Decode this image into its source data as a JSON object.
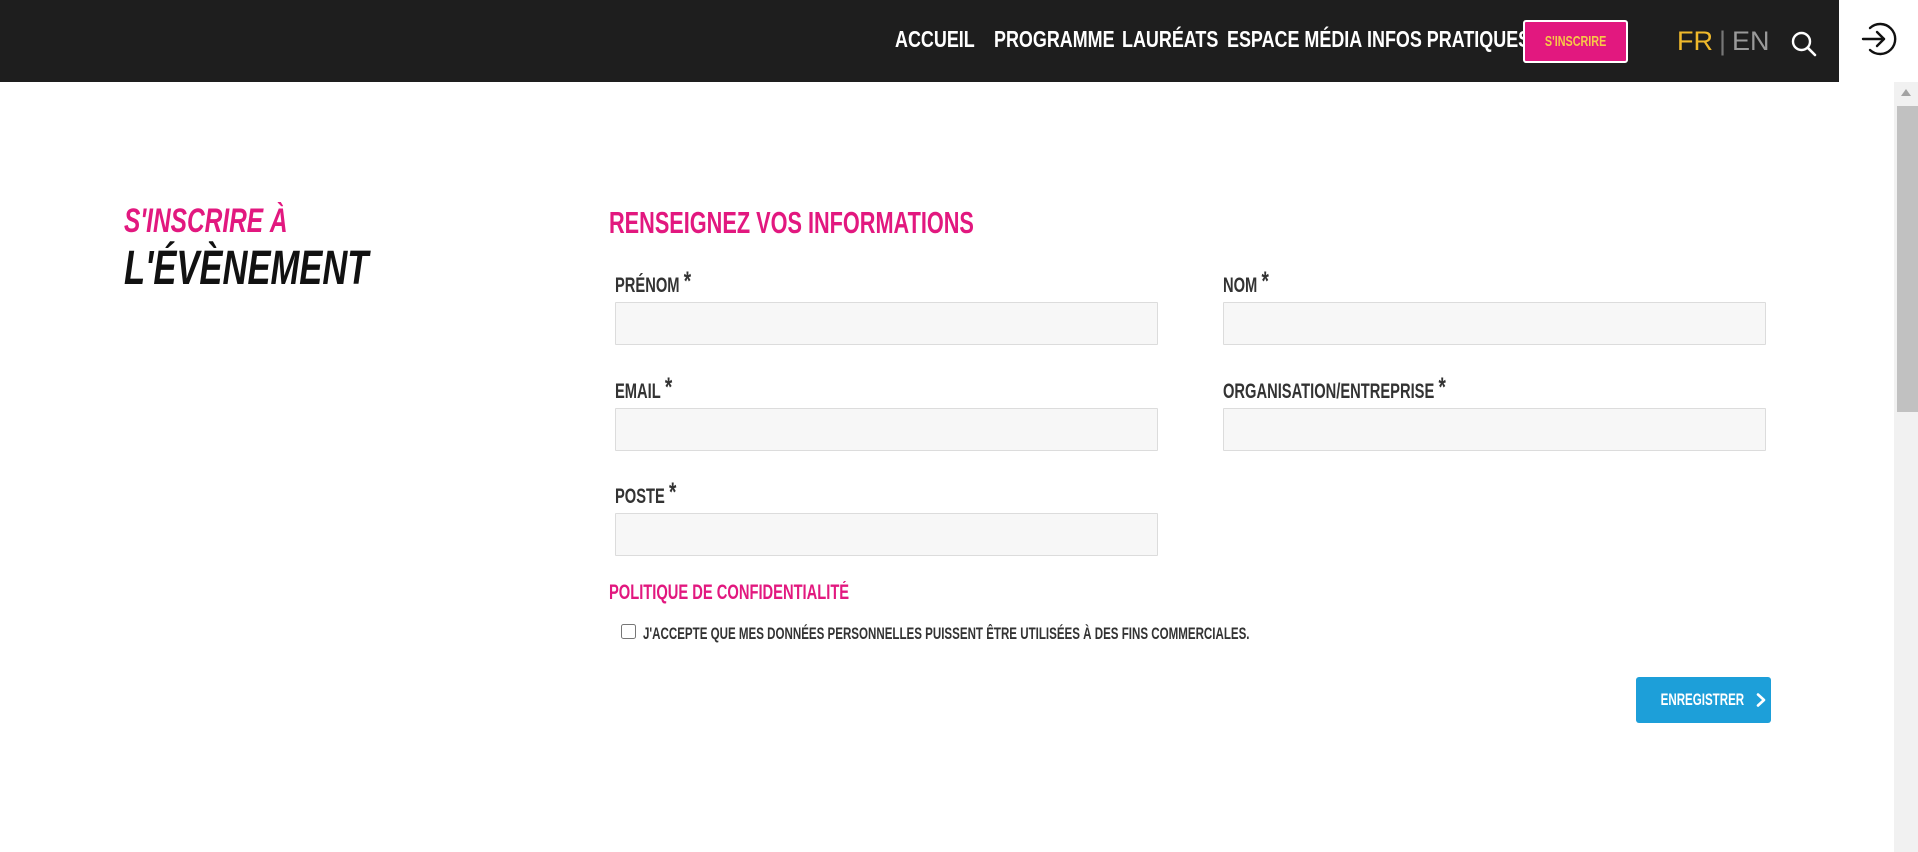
{
  "header": {
    "nav": [
      "Accueil",
      "Programme",
      "Lauréats",
      "Espace média",
      "Infos pratiques"
    ],
    "signup_label": "S'inscrire",
    "lang": {
      "fr": "FR",
      "separator": "|",
      "en": "EN"
    }
  },
  "intro": {
    "title_small": "S'inscrire à",
    "title_big": "L'évènement"
  },
  "form": {
    "heading": "Renseignez vos informations",
    "required_mark": "*",
    "fields": {
      "prenom": {
        "label": "Prénom",
        "value": ""
      },
      "nom": {
        "label": "Nom",
        "value": ""
      },
      "email": {
        "label": "Email",
        "value": ""
      },
      "organisation": {
        "label": "Organisation/Entreprise",
        "value": ""
      },
      "poste": {
        "label": "Poste",
        "value": ""
      }
    },
    "privacy": {
      "heading": "Politique de confidentialité",
      "consent_label": "J'accepte que mes données personnelles puissent être utilisées à des fins commerciales.",
      "consent_checked": false
    },
    "submit_label": "Enregistrer"
  },
  "colors": {
    "header_bg": "#1e1e1e",
    "accent_pink": "#e2187f",
    "accent_yellow": "#f0b92b",
    "submit_blue": "#1d9fd9"
  },
  "icons": {
    "search": "search-icon",
    "login": "login-icon",
    "submit": "chevron-right-icon"
  }
}
